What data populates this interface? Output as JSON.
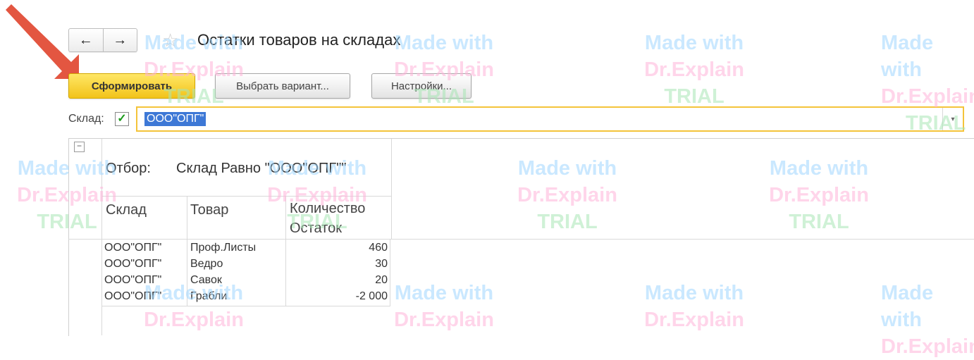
{
  "window": {
    "title": "Остатки товаров на складах",
    "back_icon": "←",
    "forward_icon": "→",
    "favorite_icon": "☆"
  },
  "toolbar": {
    "generate_label": "Сформировать",
    "choose_variant_label": "Выбрать вариант...",
    "settings_label": "Настройки..."
  },
  "filter_field": {
    "label": "Склад:",
    "checked": true,
    "check_mark": "✓",
    "value": "ООО\"ОПГ\"",
    "dropdown_icon": "▾"
  },
  "report": {
    "collapse_icon": "−",
    "filter_label": "Отбор:",
    "filter_value": "Склад Равно \"ООО\"ОПГ\"\"",
    "headers": {
      "warehouse": "Склад",
      "product": "Товар",
      "quantity_line1": "Количество",
      "quantity_line2": "Остаток"
    },
    "rows": [
      {
        "warehouse": "ООО\"ОПГ\"",
        "product": "Проф.Листы",
        "quantity": "460"
      },
      {
        "warehouse": "ООО\"ОПГ\"",
        "product": "Ведро",
        "quantity": "30"
      },
      {
        "warehouse": "ООО\"ОПГ\"",
        "product": "Савок",
        "quantity": "20"
      },
      {
        "warehouse": "ООО\"ОПГ\"",
        "product": "Грабли",
        "quantity": "-2 000"
      }
    ]
  },
  "watermark": {
    "line1": "Made with",
    "line2": "Dr.Explain",
    "line3": "TRIAL"
  },
  "colors": {
    "primary_button": "#f2c31a",
    "field_border": "#f4c43a",
    "selection": "#3d78d6",
    "check": "#1a9a1a",
    "annotation_arrow": "#e0442c"
  }
}
